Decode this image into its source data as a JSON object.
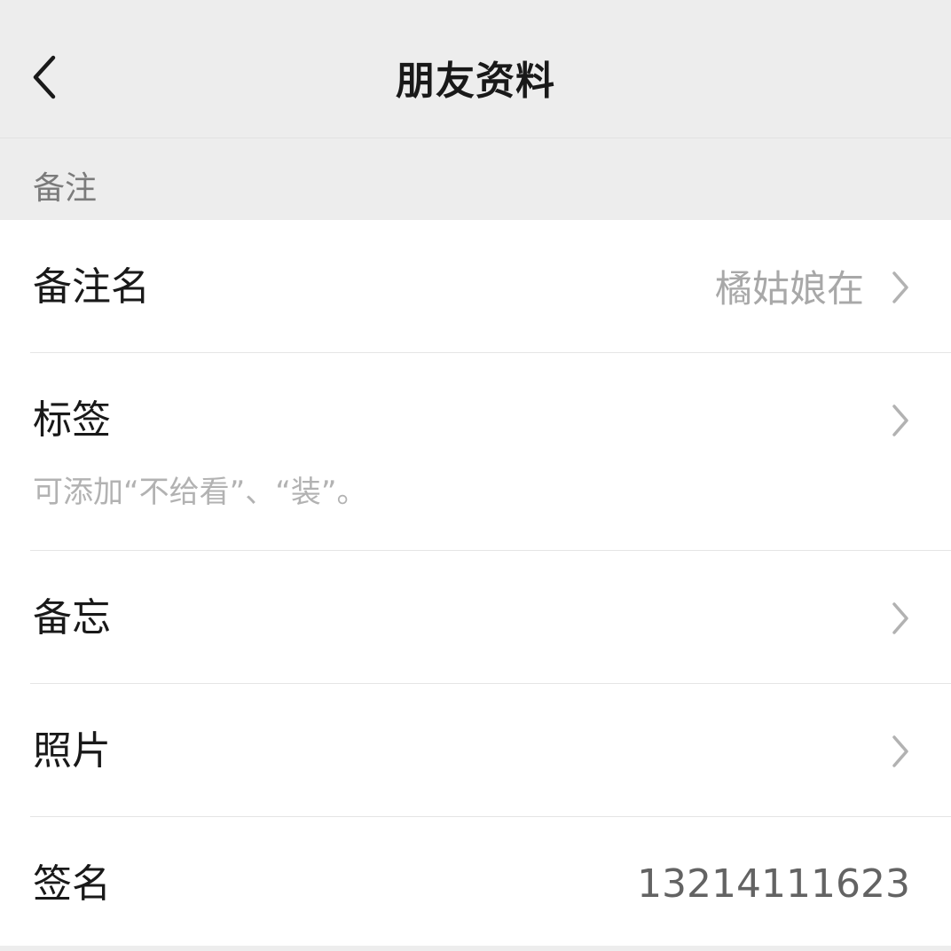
{
  "nav": {
    "title": "朋友资料",
    "back_icon": "chevron-left-icon"
  },
  "section": {
    "header": "备注"
  },
  "rows": [
    {
      "label": "备注名",
      "value": "橘姑娘在",
      "has_chevron": true
    },
    {
      "label": "标签",
      "subtitle": "可添加“不给看”、“装”。",
      "has_chevron": true
    },
    {
      "label": "备忘",
      "has_chevron": true
    },
    {
      "label": "照片",
      "has_chevron": true
    },
    {
      "label": "签名",
      "value": "13214111623",
      "has_chevron": false
    }
  ],
  "colors": {
    "background": "#ededed",
    "card": "#ffffff",
    "text_primary": "#191919",
    "text_secondary": "#a8a8a8",
    "divider": "#e5e5e5"
  }
}
